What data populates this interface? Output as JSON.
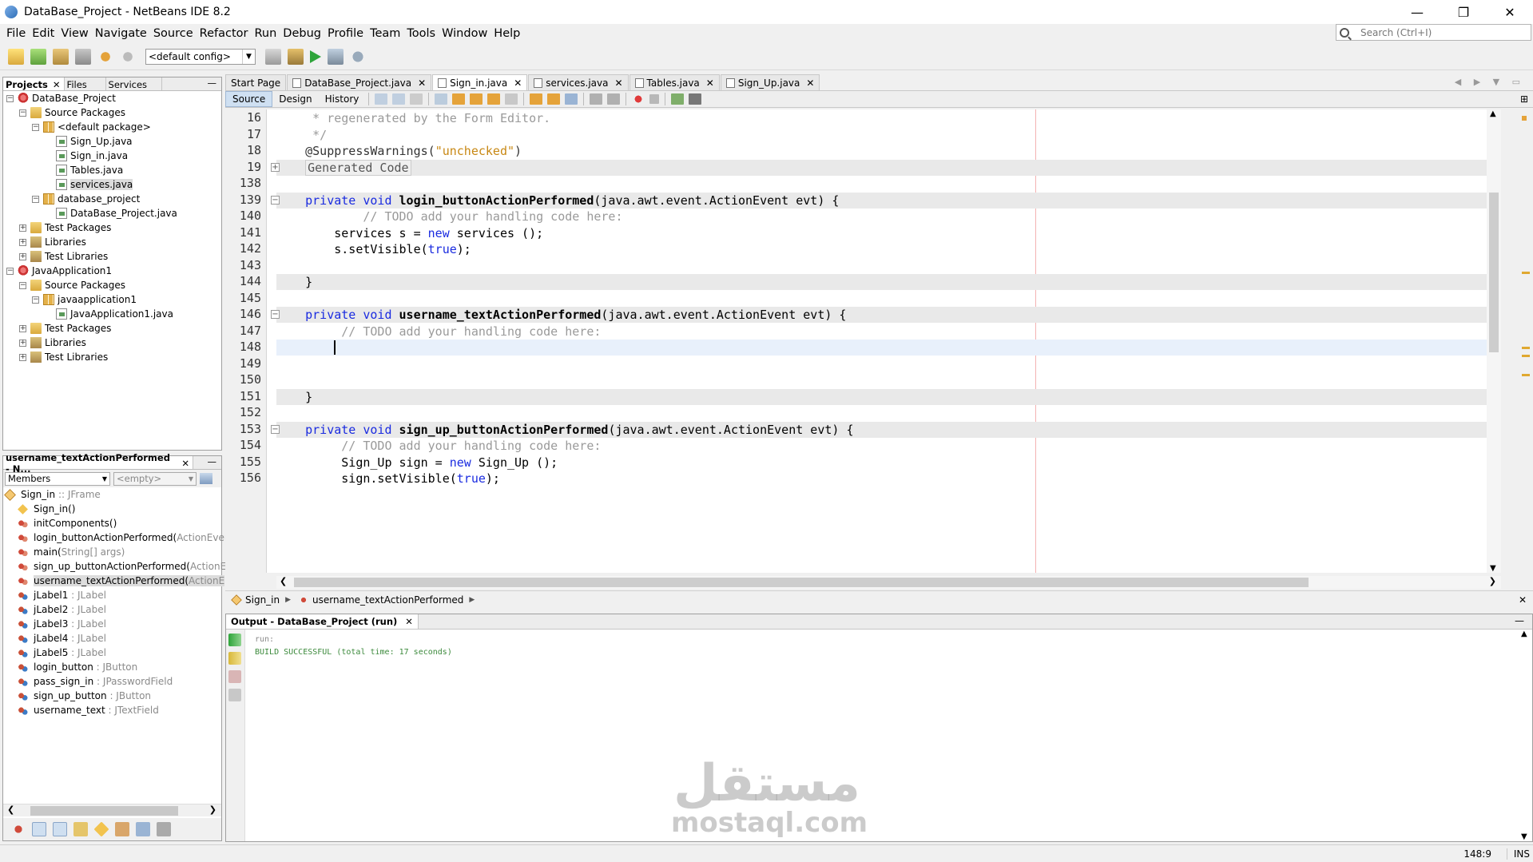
{
  "window": {
    "title": "DataBase_Project - NetBeans IDE 8.2",
    "controls": [
      "—",
      "❐",
      "✕"
    ]
  },
  "menu": [
    "File",
    "Edit",
    "View",
    "Navigate",
    "Source",
    "Refactor",
    "Run",
    "Debug",
    "Profile",
    "Team",
    "Tools",
    "Window",
    "Help"
  ],
  "search": {
    "placeholder": "Search (Ctrl+I)"
  },
  "toolbar": {
    "config": "<default config>"
  },
  "projects_panel": {
    "tabs": [
      "Projects",
      "Files",
      "Services"
    ],
    "tree": [
      {
        "label": "DataBase_Project",
        "level": 0,
        "icon": "project",
        "expander": "−"
      },
      {
        "label": "Source Packages",
        "level": 1,
        "icon": "folder",
        "expander": "−"
      },
      {
        "label": "<default package>",
        "level": 2,
        "icon": "pkg",
        "expander": "−"
      },
      {
        "label": "Sign_Up.java",
        "level": 3,
        "icon": "java",
        "expander": ""
      },
      {
        "label": "Sign_in.java",
        "level": 3,
        "icon": "java",
        "expander": ""
      },
      {
        "label": "Tables.java",
        "level": 3,
        "icon": "java",
        "expander": ""
      },
      {
        "label": "services.java",
        "level": 3,
        "icon": "java",
        "expander": "",
        "selected": true
      },
      {
        "label": "database_project",
        "level": 2,
        "icon": "pkg",
        "expander": "−"
      },
      {
        "label": "DataBase_Project.java",
        "level": 3,
        "icon": "java",
        "expander": ""
      },
      {
        "label": "Test Packages",
        "level": 1,
        "icon": "folder",
        "expander": "+"
      },
      {
        "label": "Libraries",
        "level": 1,
        "icon": "lib",
        "expander": "+"
      },
      {
        "label": "Test Libraries",
        "level": 1,
        "icon": "lib",
        "expander": "+"
      },
      {
        "label": "JavaApplication1",
        "level": 0,
        "icon": "project",
        "expander": "−"
      },
      {
        "label": "Source Packages",
        "level": 1,
        "icon": "folder",
        "expander": "−"
      },
      {
        "label": "javaapplication1",
        "level": 2,
        "icon": "pkg",
        "expander": "−"
      },
      {
        "label": "JavaApplication1.java",
        "level": 3,
        "icon": "java",
        "expander": ""
      },
      {
        "label": "Test Packages",
        "level": 1,
        "icon": "folder",
        "expander": "+"
      },
      {
        "label": "Libraries",
        "level": 1,
        "icon": "lib",
        "expander": "+"
      },
      {
        "label": "Test Libraries",
        "level": 1,
        "icon": "lib",
        "expander": "+"
      }
    ]
  },
  "navigator": {
    "title": "username_textActionPerformed - N...",
    "filter": "Members",
    "empty": "<empty>",
    "members": [
      {
        "name": "Sign_in",
        "type": ":: JFrame",
        "icon": "cls",
        "level": 0
      },
      {
        "name": "Sign_in()",
        "type": "",
        "icon": "ctor",
        "level": 1
      },
      {
        "name": "initComponents()",
        "type": "",
        "icon": "meth",
        "level": 1
      },
      {
        "name": "login_buttonActionPerformed(",
        "type": "ActionEven",
        "icon": "meth",
        "level": 1
      },
      {
        "name": "main(",
        "type": "String[] args)",
        "icon": "meth",
        "level": 1
      },
      {
        "name": "sign_up_buttonActionPerformed(",
        "type": "ActionE",
        "icon": "meth",
        "level": 1
      },
      {
        "name": "username_textActionPerformed(",
        "type": "ActionE",
        "icon": "meth",
        "level": 1,
        "selected": true
      },
      {
        "name": "jLabel1",
        "type": ": JLabel",
        "icon": "field",
        "level": 1
      },
      {
        "name": "jLabel2",
        "type": ": JLabel",
        "icon": "field",
        "level": 1
      },
      {
        "name": "jLabel3",
        "type": ": JLabel",
        "icon": "field",
        "level": 1
      },
      {
        "name": "jLabel4",
        "type": ": JLabel",
        "icon": "field",
        "level": 1
      },
      {
        "name": "jLabel5",
        "type": ": JLabel",
        "icon": "field",
        "level": 1
      },
      {
        "name": "login_button",
        "type": ": JButton",
        "icon": "field",
        "level": 1
      },
      {
        "name": "pass_sign_in",
        "type": ": JPasswordField",
        "icon": "field",
        "level": 1
      },
      {
        "name": "sign_up_button",
        "type": ": JButton",
        "icon": "field",
        "level": 1
      },
      {
        "name": "username_text",
        "type": ": JTextField",
        "icon": "field",
        "level": 1
      }
    ]
  },
  "editor": {
    "tabs": [
      {
        "label": "Start Page",
        "active": false,
        "icon": false
      },
      {
        "label": "DataBase_Project.java",
        "active": false,
        "icon": true
      },
      {
        "label": "Sign_in.java",
        "active": true,
        "icon": true
      },
      {
        "label": "services.java",
        "active": false,
        "icon": true
      },
      {
        "label": "Tables.java",
        "active": false,
        "icon": true
      },
      {
        "label": "Sign_Up.java",
        "active": false,
        "icon": true
      }
    ],
    "views": [
      "Source",
      "Design",
      "History"
    ],
    "active_view": "Source",
    "lines": [
      {
        "n": "16",
        "seg": [
          [
            "cm",
            " * regenerated by the Form Editor."
          ]
        ]
      },
      {
        "n": "17",
        "seg": [
          [
            "cm",
            " */"
          ]
        ]
      },
      {
        "n": "18",
        "seg": [
          [
            "ann",
            "@SuppressWarnings("
          ],
          [
            "str",
            "\"unchecked\""
          ],
          [
            "ann",
            ")"
          ]
        ]
      },
      {
        "n": "19",
        "hl": true,
        "fold": "+",
        "seg": [
          [
            "gen",
            "Generated Code"
          ]
        ]
      },
      {
        "n": "138",
        "seg": []
      },
      {
        "n": "139",
        "hl": true,
        "fold": "−",
        "seg": [
          [
            "kw",
            "private void "
          ],
          [
            "bold",
            "login_buttonActionPerformed"
          ],
          [
            "",
            "(java.awt.event.ActionEvent evt) {"
          ]
        ]
      },
      {
        "n": "140",
        "seg": [
          [
            "cm",
            "        // TODO add your handling code here:"
          ]
        ]
      },
      {
        "n": "141",
        "seg": [
          [
            "",
            "    services s = "
          ],
          [
            "kw",
            "new"
          ],
          [
            "",
            " services ();"
          ]
        ]
      },
      {
        "n": "142",
        "seg": [
          [
            "",
            "    s.setVisible("
          ],
          [
            "kw",
            "true"
          ],
          [
            "",
            ");"
          ]
        ]
      },
      {
        "n": "143",
        "seg": []
      },
      {
        "n": "144",
        "hl": true,
        "seg": [
          [
            "",
            "}"
          ]
        ]
      },
      {
        "n": "145",
        "seg": []
      },
      {
        "n": "146",
        "hl": true,
        "fold": "−",
        "seg": [
          [
            "kw",
            "private void "
          ],
          [
            "bold",
            "username_textActionPerformed"
          ],
          [
            "",
            "(java.awt.event.ActionEvent evt) {"
          ]
        ]
      },
      {
        "n": "147",
        "seg": [
          [
            "cm",
            "     // TODO add your handling code here:"
          ]
        ]
      },
      {
        "n": "148",
        "cur": true,
        "seg": []
      },
      {
        "n": "149",
        "seg": []
      },
      {
        "n": "150",
        "seg": []
      },
      {
        "n": "151",
        "hl": true,
        "seg": [
          [
            "",
            "}"
          ]
        ]
      },
      {
        "n": "152",
        "seg": []
      },
      {
        "n": "153",
        "hl": true,
        "fold": "−",
        "seg": [
          [
            "kw",
            "private void "
          ],
          [
            "bold",
            "sign_up_buttonActionPerformed"
          ],
          [
            "",
            "(java.awt.event.ActionEvent evt) {"
          ]
        ]
      },
      {
        "n": "154",
        "seg": [
          [
            "cm",
            "     // TODO add your handling code here:"
          ]
        ]
      },
      {
        "n": "155",
        "seg": [
          [
            "",
            "     Sign_Up sign = "
          ],
          [
            "kw",
            "new"
          ],
          [
            "",
            " Sign_Up ();"
          ]
        ]
      },
      {
        "n": "156",
        "seg": [
          [
            "",
            "     sign.setVisible("
          ],
          [
            "kw",
            "true"
          ],
          [
            "",
            ");"
          ]
        ]
      }
    ],
    "breadcrumbs": [
      "Sign_in",
      "username_textActionPerformed"
    ]
  },
  "output": {
    "tab": "Output - DataBase_Project (run)",
    "lines": [
      {
        "cls": "run",
        "text": "run:"
      },
      {
        "cls": "ok",
        "text": "BUILD SUCCESSFUL (total time: 17 seconds)"
      }
    ]
  },
  "status": {
    "position": "148:9",
    "mode": "INS"
  },
  "watermark": {
    "arabic": "مستقل",
    "latin": "mostaql.com"
  },
  "colors": {
    "keyword": "#1a2be0",
    "string": "#c88814",
    "comment": "#9a9a9a",
    "success": "#3c8a3c"
  }
}
